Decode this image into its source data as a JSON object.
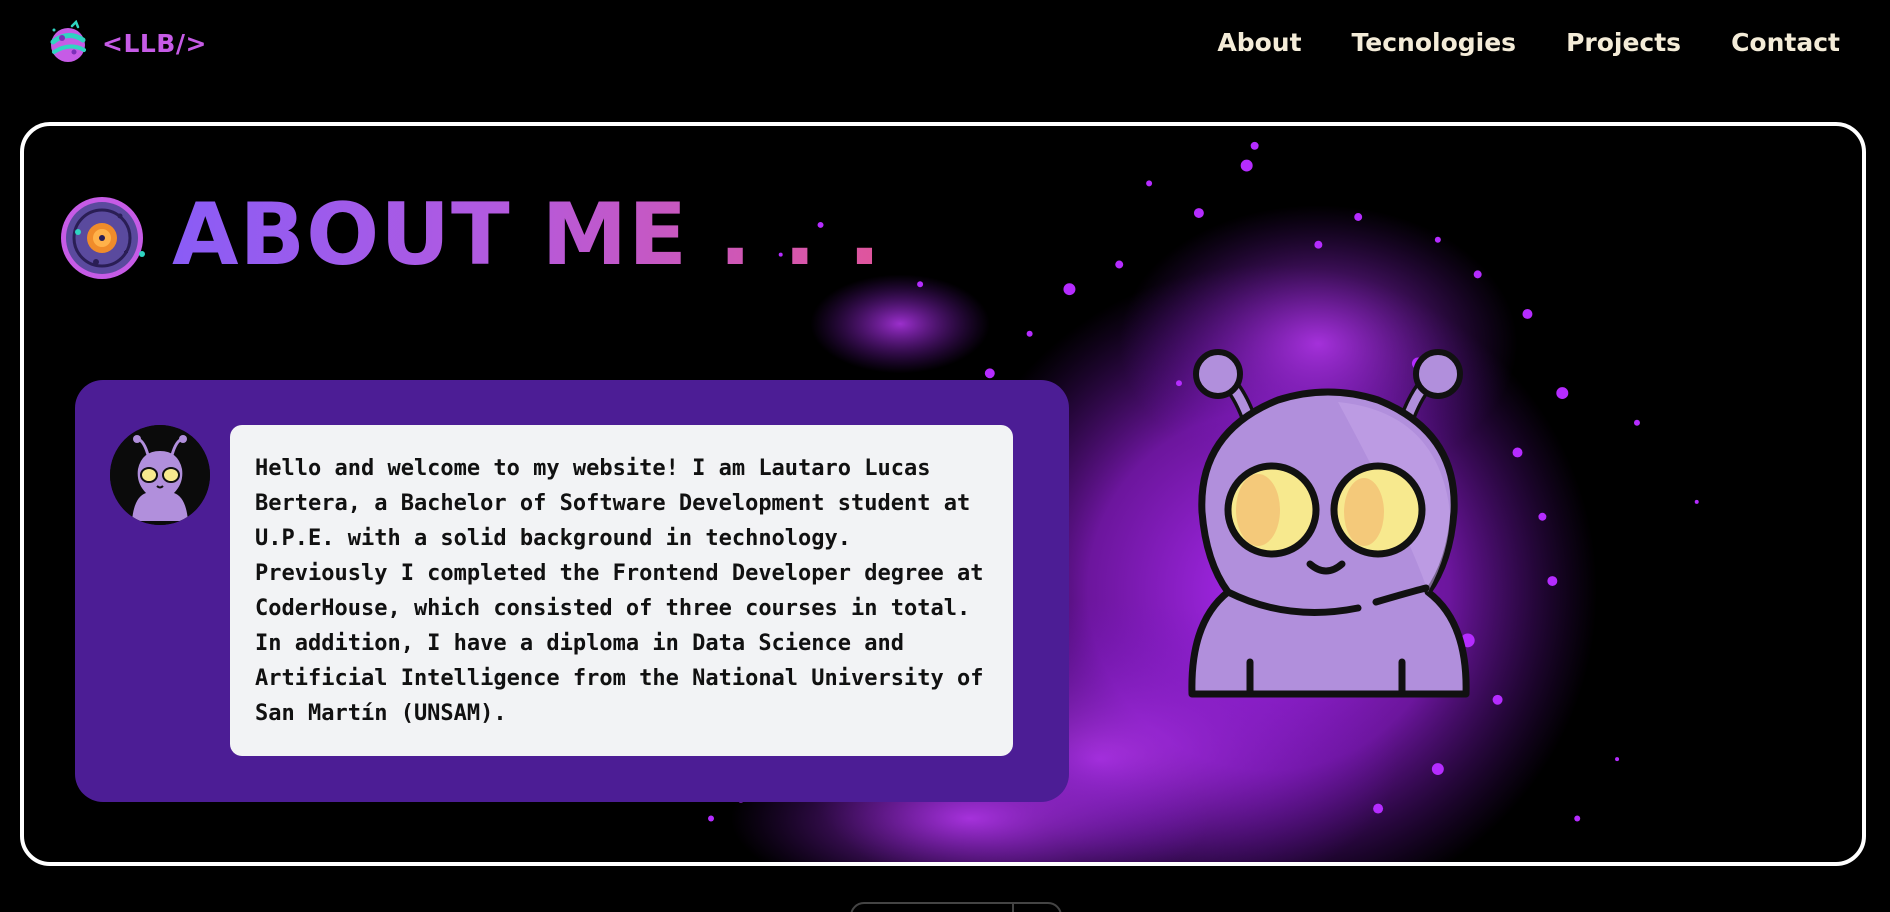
{
  "header": {
    "logo_text": "<LLB/>",
    "nav": [
      {
        "label": "About"
      },
      {
        "label": "Tecnologies"
      },
      {
        "label": "Projects"
      },
      {
        "label": "Contact"
      }
    ]
  },
  "about": {
    "title": "ABOUT ME . . .",
    "bio": "Hello and welcome to my website! I am Lautaro Lucas Bertera, a Bachelor of Software Development student at U.P.E. with a solid background in technology. Previously I completed the Frontend Developer degree at CoderHouse, which consisted of three courses in total. In addition, I have a diploma in Data Science and Artificial Intelligence from the National University of San Martín (UNSAM)."
  },
  "colors": {
    "background": "#000000",
    "accent_purple": "#4c1d95",
    "logo_purple": "#c65be6",
    "nav_text": "#f4ecd8",
    "title_gradient_start": "#8a5cf6",
    "title_gradient_end": "#e0559c",
    "splash": "#a020f0",
    "alien_body": "#b18fdc",
    "alien_eye": "#f7e98e"
  },
  "icons": {
    "logo": "planet-icon",
    "title": "galaxy-icon",
    "avatar": "alien-avatar",
    "illustration": "alien-illustration"
  }
}
